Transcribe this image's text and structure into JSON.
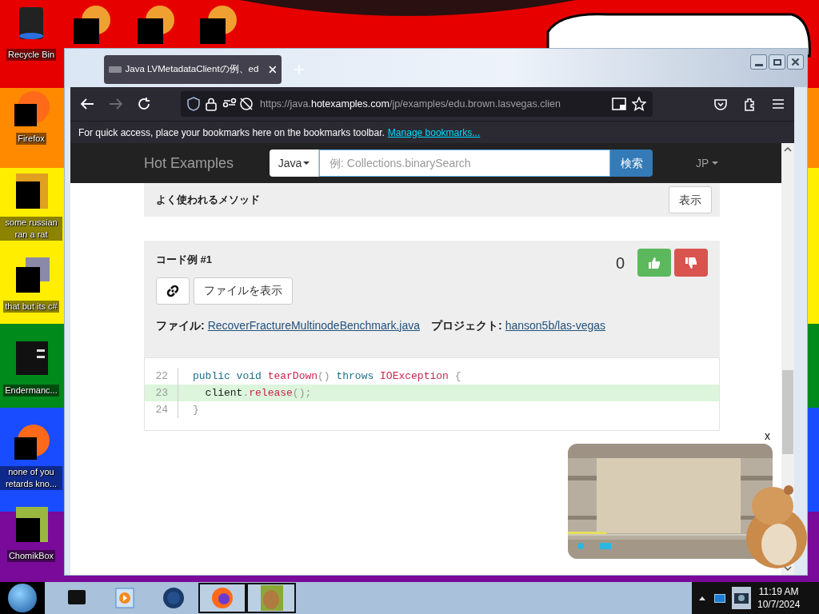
{
  "desktop": {
    "icons": [
      {
        "label": "Recycle Bin",
        "kind": "bin"
      },
      {
        "label": "Firefox",
        "kind": "fox"
      },
      {
        "label": "some russian ran a rat",
        "kind": "doc"
      },
      {
        "label": "that but its c#",
        "kind": "stack"
      },
      {
        "label": "Endermanc...",
        "kind": "window"
      },
      {
        "label": "none of you retards kno...",
        "kind": "fox"
      },
      {
        "label": "ChomikBox",
        "kind": "box"
      }
    ]
  },
  "browser": {
    "tab": {
      "title": "Java LVMetadataClientの例、ed",
      "selected": true
    },
    "url": [
      {
        "text": "https://java.",
        "strong": false
      },
      {
        "text": "hotexamples.com",
        "strong": true
      },
      {
        "text": "/jp/examples/edu.brown.lasvegas.clien",
        "strong": false
      }
    ],
    "bookmarks_bar": {
      "text": "For quick access, place your bookmarks here on the bookmarks toolbar.",
      "link": "Manage bookmarks..."
    }
  },
  "page": {
    "navbar": {
      "brand": "Hot Examples",
      "language_select": "Java",
      "search": {
        "placeholder": "例: Collections.binarySearch",
        "button": "検索"
      },
      "locale": "JP"
    },
    "methods_panel": {
      "title": "よく使われるメソッド",
      "button": "表示"
    },
    "example": {
      "title": "コード例 #1",
      "score": "0",
      "view_file_button": "ファイルを表示",
      "file_label": "ファイル:",
      "file_link": "RecoverFractureMultinodeBenchmark.java",
      "project_label": "プロジェクト:",
      "project_link": "hanson5b/las-vegas",
      "code": [
        {
          "number": "22",
          "highlighted": false,
          "tokens": [
            {
              "kind": "keyword",
              "text": "public void "
            },
            {
              "kind": "function",
              "text": "tearDown"
            },
            {
              "kind": "punct",
              "text": "() "
            },
            {
              "kind": "keyword",
              "text": "throws "
            },
            {
              "kind": "type",
              "text": "IOException"
            },
            {
              "kind": "punct",
              "text": " {"
            }
          ]
        },
        {
          "number": "23",
          "highlighted": true,
          "tokens": [
            {
              "kind": "plain",
              "text": "  client"
            },
            {
              "kind": "punct",
              "text": "."
            },
            {
              "kind": "function",
              "text": "release"
            },
            {
              "kind": "punct",
              "text": "();"
            }
          ]
        },
        {
          "number": "24",
          "highlighted": false,
          "tokens": [
            {
              "kind": "punct",
              "text": "}"
            }
          ]
        }
      ]
    },
    "video_ad": {
      "close": "x"
    }
  },
  "taskbar": {
    "items": [
      {
        "kind": "device",
        "selected": false
      },
      {
        "kind": "media",
        "selected": false
      },
      {
        "kind": "globe",
        "selected": false
      },
      {
        "kind": "fox",
        "selected": true
      },
      {
        "kind": "box",
        "selected": true
      }
    ],
    "time": "11:19 AM",
    "date": "10/7/2024"
  }
}
